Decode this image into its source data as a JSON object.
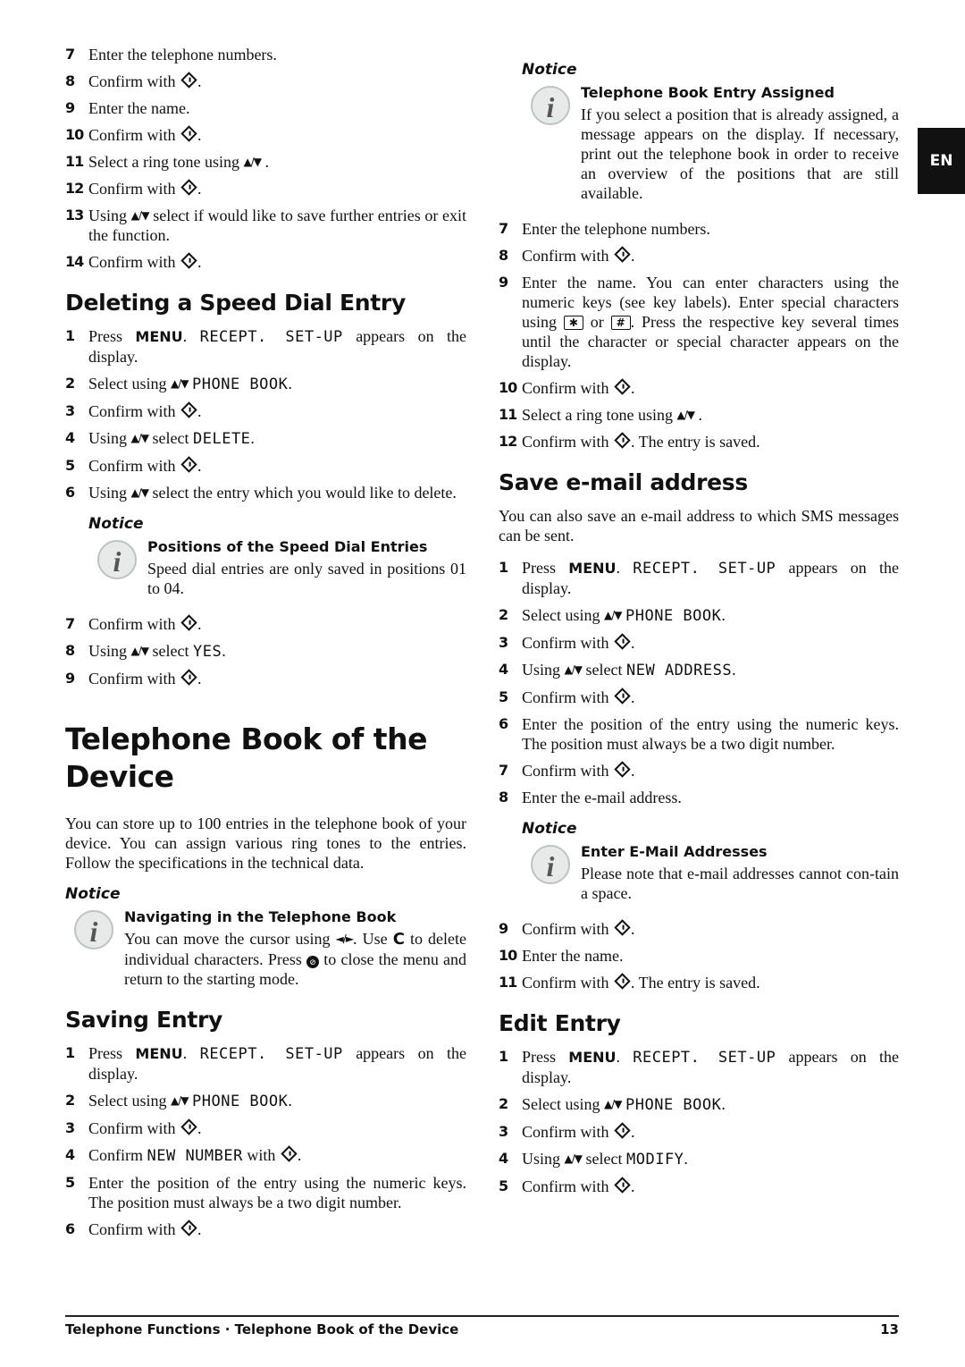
{
  "language_tab": "EN",
  "footer": {
    "breadcrumb": "Telephone Functions · Telephone Book of the Device",
    "page_number": "13"
  },
  "icons": {
    "ok": "ok-key-icon",
    "updown": "up-down-arrow-icon",
    "info": "info-icon",
    "stop": "stop-key-icon",
    "leftright": "left-right-arrow-icon"
  },
  "left": {
    "intro_steps": [
      {
        "n": "7",
        "text": "Enter the telephone numbers."
      },
      {
        "n": "8",
        "text": "Confirm with",
        "ok": true,
        "tail": "."
      },
      {
        "n": "9",
        "text": "Enter the name."
      },
      {
        "n": "10",
        "text": "Confirm with",
        "ok": true,
        "tail": "."
      },
      {
        "n": "11",
        "text": "Select a ring tone using",
        "updown": true,
        "tail": "."
      },
      {
        "n": "12",
        "text": "Confirm with",
        "ok": true,
        "tail": "."
      },
      {
        "n": "13",
        "text": "Using",
        "updown": true,
        "tail": "select if would like to save further entries or exit the function."
      },
      {
        "n": "14",
        "text": "Confirm with",
        "ok": true,
        "tail": "."
      }
    ],
    "deleting": {
      "title": "Deleting a Speed Dial Entry",
      "steps_a": [
        {
          "n": "1",
          "pre": "Press",
          "key": "MENU",
          "mid": ".",
          "lcd": "RECEPT.  SET-UP",
          "post": "appears on the display."
        },
        {
          "n": "2",
          "pre": "Select using",
          "updown": true,
          "lcd": "PHONE BOOK",
          "post": "."
        },
        {
          "n": "3",
          "pre": "Confirm with",
          "ok": true,
          "post": "."
        },
        {
          "n": "4",
          "pre": "Using",
          "updown": true,
          "mid": "select",
          "lcd": "DELETE",
          "post": "."
        },
        {
          "n": "5",
          "pre": "Confirm with",
          "ok": true,
          "post": "."
        },
        {
          "n": "6",
          "pre": "Using",
          "updown": true,
          "post": "select the entry which you would like to delete."
        }
      ],
      "notice": {
        "label": "Notice",
        "title": "Positions of the Speed Dial Entries",
        "text": "Speed dial entries are only saved in positions 01 to 04."
      },
      "steps_b": [
        {
          "n": "7",
          "pre": "Confirm with",
          "ok": true,
          "post": "."
        },
        {
          "n": "8",
          "pre": "Using",
          "updown": true,
          "mid": "select",
          "lcd": "YES",
          "post": "."
        },
        {
          "n": "9",
          "pre": "Confirm with",
          "ok": true,
          "post": "."
        }
      ]
    },
    "chapter": {
      "title_line1": "Telephone Book of the",
      "title_line2": "Device",
      "intro": "You can store up to 100 entries in the telephone book of your device. You can assign various ring tones to the entries. Follow the specifications in the technical data.",
      "notice": {
        "label": "Notice",
        "title": "Navigating in the Telephone Book",
        "text_a": "You can move the cursor using",
        "arrows": "◄/►",
        "text_b": ". Use",
        "key_c": "C",
        "text_c": "to delete individual characters. Press",
        "text_d": "to close the menu and return to the starting mode."
      }
    },
    "saving": {
      "title": "Saving Entry",
      "steps": [
        {
          "n": "1",
          "pre": "Press",
          "key": "MENU",
          "mid": ".",
          "lcd": "RECEPT.  SET-UP",
          "post": "appears on the display."
        },
        {
          "n": "2",
          "pre": "Select using",
          "updown": true,
          "lcd": "PHONE BOOK",
          "post": "."
        },
        {
          "n": "3",
          "pre": "Confirm with",
          "ok": true,
          "post": "."
        },
        {
          "n": "4",
          "pre": "Confirm",
          "lcd": "NEW NUMBER",
          "post2": "with",
          "ok2": true,
          "post": "."
        },
        {
          "n": "5",
          "pre": "Enter the position of the entry using the numeric keys. The position must always be a two digit number."
        },
        {
          "n": "6",
          "pre": "Confirm with",
          "ok": true,
          "post": "."
        }
      ]
    }
  },
  "right": {
    "notice_assigned": {
      "label": "Notice",
      "title": "Telephone Book Entry Assigned",
      "text": "If you select a position that is already assigned, a message appears on the display. If necessary, print out the telephone book in order to receive an overview of the positions that are still available."
    },
    "steps": [
      {
        "n": "7",
        "pre": "Enter the telephone numbers."
      },
      {
        "n": "8",
        "pre": "Confirm with",
        "ok": true,
        "post": "."
      },
      {
        "n": "9",
        "pre": "Enter the name. You can enter characters using the numeric keys (see key labels).  Enter special characters using",
        "key1": "✱",
        "or": "or",
        "key2": "#",
        "post": ". Press the respective key several times until the character or special character appears on the display."
      },
      {
        "n": "10",
        "pre": "Confirm with",
        "ok": true,
        "post": "."
      },
      {
        "n": "11",
        "pre": "Select a ring tone using",
        "updown": true,
        "post": "."
      },
      {
        "n": "12",
        "pre": "Confirm with",
        "ok": true,
        "post": ". The entry is saved."
      }
    ],
    "email": {
      "title": "Save e-mail address",
      "intro": "You can also save an e-mail address to which SMS messages can be sent.",
      "steps_a": [
        {
          "n": "1",
          "pre": "Press",
          "key": "MENU",
          "mid": ".",
          "lcd": "RECEPT.  SET-UP",
          "post": "appears on the display."
        },
        {
          "n": "2",
          "pre": "Select using",
          "updown": true,
          "lcd": "PHONE BOOK",
          "post": "."
        },
        {
          "n": "3",
          "pre": "Confirm with",
          "ok": true,
          "post": "."
        },
        {
          "n": "4",
          "pre": "Using",
          "updown": true,
          "mid": "select",
          "lcd": "NEW ADDRESS",
          "post": "."
        },
        {
          "n": "5",
          "pre": "Confirm with",
          "ok": true,
          "post": "."
        },
        {
          "n": "6",
          "pre": "Enter the position of the entry using the numeric keys. The position must always be a two digit number."
        },
        {
          "n": "7",
          "pre": "Confirm with",
          "ok": true,
          "post": "."
        },
        {
          "n": "8",
          "pre": "Enter the e-mail address."
        }
      ],
      "notice": {
        "label": "Notice",
        "title": "Enter E-Mail Addresses",
        "text": "Please note that e-mail addresses cannot con-tain a space."
      },
      "steps_b": [
        {
          "n": "9",
          "pre": "Confirm with",
          "ok": true,
          "post": "."
        },
        {
          "n": "10",
          "pre": "Enter the name."
        },
        {
          "n": "11",
          "pre": "Confirm with",
          "ok": true,
          "post": ". The entry is saved."
        }
      ]
    },
    "edit": {
      "title": "Edit Entry",
      "steps": [
        {
          "n": "1",
          "pre": "Press",
          "key": "MENU",
          "mid": ".",
          "lcd": "RECEPT.  SET-UP",
          "post": "appears on the display."
        },
        {
          "n": "2",
          "pre": "Select using",
          "updown": true,
          "lcd": "PHONE BOOK",
          "post": "."
        },
        {
          "n": "3",
          "pre": "Confirm with",
          "ok": true,
          "post": "."
        },
        {
          "n": "4",
          "pre": "Using",
          "updown": true,
          "mid": "select",
          "lcd": "MODIFY",
          "post": "."
        },
        {
          "n": "5",
          "pre": "Confirm with",
          "ok": true,
          "post": "."
        }
      ]
    }
  }
}
